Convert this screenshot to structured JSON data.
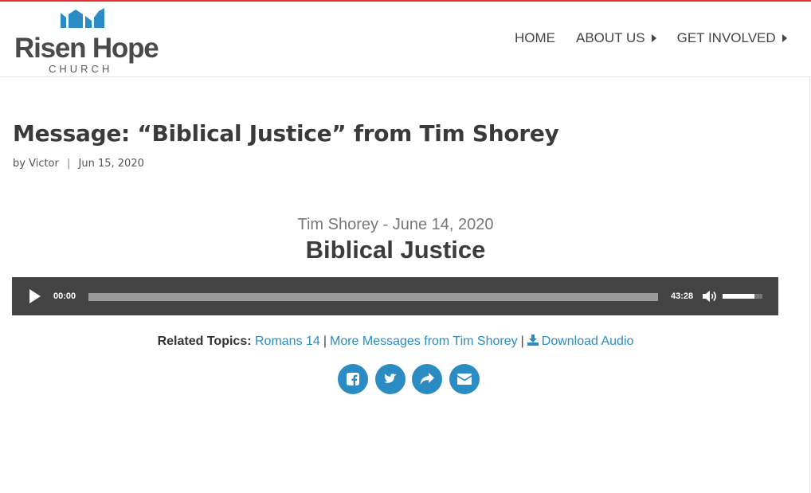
{
  "brand": {
    "name": "Risen Hope",
    "subtitle": "CHURCH",
    "accent_color": "#2b8cc4",
    "top_bar_color": "#e0322f"
  },
  "nav": {
    "items": [
      {
        "label": "HOME",
        "has_dropdown": false
      },
      {
        "label": "ABOUT US",
        "has_dropdown": true
      },
      {
        "label": "GET INVOLVED",
        "has_dropdown": true
      }
    ]
  },
  "post": {
    "title": "Message: “Biblical Justice” from Tim Shorey",
    "by_label": "by",
    "author": "Victor",
    "separator": "|",
    "date": "Jun 15, 2020"
  },
  "sermon": {
    "subtitle": "Tim Shorey - June 14, 2020",
    "title": "Biblical Justice"
  },
  "player": {
    "current_time": "00:00",
    "duration": "43:28",
    "progress_fraction": 0,
    "volume_fraction": 0.8,
    "icons": {
      "play": "play-icon",
      "mute": "volume-icon"
    }
  },
  "related": {
    "label": "Related Topics:",
    "topic": "Romans 14",
    "more_messages": "More Messages from Tim Shorey",
    "download": "Download Audio",
    "separator": "|"
  },
  "share": {
    "icons": [
      "facebook-icon",
      "twitter-icon",
      "share-icon",
      "email-icon"
    ]
  }
}
